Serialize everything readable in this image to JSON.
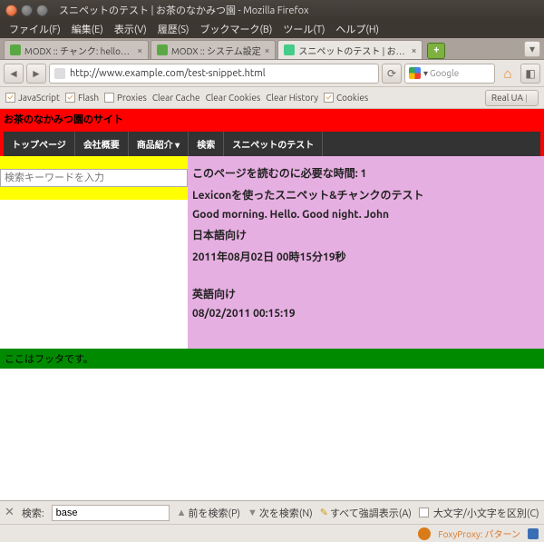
{
  "window": {
    "title": "スニペットのテスト | お茶のなかみつ園 - Mozilla Firefox"
  },
  "menubar": {
    "file": "ファイル(F)",
    "edit": "編集(E)",
    "view": "表示(V)",
    "history": "履歴(S)",
    "bookmarks": "ブックマーク(B)",
    "tools": "ツール(T)",
    "help": "ヘルプ(H)"
  },
  "tabs": [
    {
      "label": "MODX :: チャンク: helloworld",
      "active": false
    },
    {
      "label": "MODX :: システム設定",
      "active": false
    },
    {
      "label": "スニペットのテスト | お茶のな…",
      "active": true
    }
  ],
  "nav": {
    "url": "http://www.example.com/test-snippet.html",
    "search_placeholder": "Google"
  },
  "toolbar": {
    "javascript": "JavaScript",
    "flash": "Flash",
    "proxies": "Proxies",
    "clearcache": "Clear Cache",
    "clearcookies": "Clear Cookies",
    "clearhistory": "Clear History",
    "cookies": "Cookies",
    "realua": "Real UA"
  },
  "page": {
    "sitename": "お茶のなかみつ園のサイト",
    "menu": [
      "トップページ",
      "会社概要",
      "商品紹介 ▾",
      "検索",
      "スニペットのテスト"
    ],
    "search_placeholder": "検索キーワードを入力",
    "lines": {
      "l1": "このページを読むのに必要な時間: 1",
      "l2": "Lexiconを使ったスニペット&チャンクのテスト",
      "l3": "Good morning. Hello. Good night. John",
      "l4": "日本語向け",
      "l5": "2011年08月02日 00時15分19秒",
      "l6": "英語向け",
      "l7": "08/02/2011 00:15:19"
    },
    "footer": "ここはフッタです。"
  },
  "findbar": {
    "label": "検索:",
    "value": "base",
    "prev": "前を検索(P)",
    "next": "次を検索(N)",
    "highlight": "すべて強調表示(A)",
    "matchcase": "大文字/小文字を区別(C)"
  },
  "status": {
    "foxy": "FoxyProxy: パターン"
  }
}
